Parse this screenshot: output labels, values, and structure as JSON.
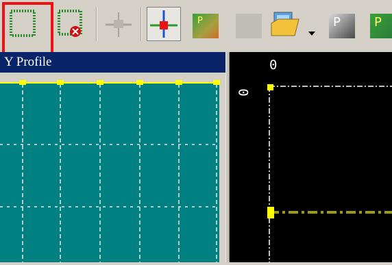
{
  "toolbar": {
    "buttons": [
      {
        "name": "select-region-icon"
      },
      {
        "name": "clear-region-icon"
      },
      {
        "name": "crosshair-disabled-icon"
      },
      {
        "name": "crosshair-point-icon"
      },
      {
        "name": "profile-gradient-icon"
      },
      {
        "name": "blank-disabled-icon"
      },
      {
        "name": "open-image-icon"
      },
      {
        "name": "dropdown-arrow-icon"
      },
      {
        "name": "p-gray-icon"
      },
      {
        "name": "p-green-icon"
      }
    ]
  },
  "left_panel": {
    "title": "Y Profile"
  },
  "right_panel": {
    "x_axis_label": "0",
    "y_axis_label": "0"
  },
  "colors": {
    "teal_plot": "#008080",
    "highlight_red": "#ee1111",
    "title_bar": "#0a246a",
    "profile_line": "#ffff00"
  }
}
